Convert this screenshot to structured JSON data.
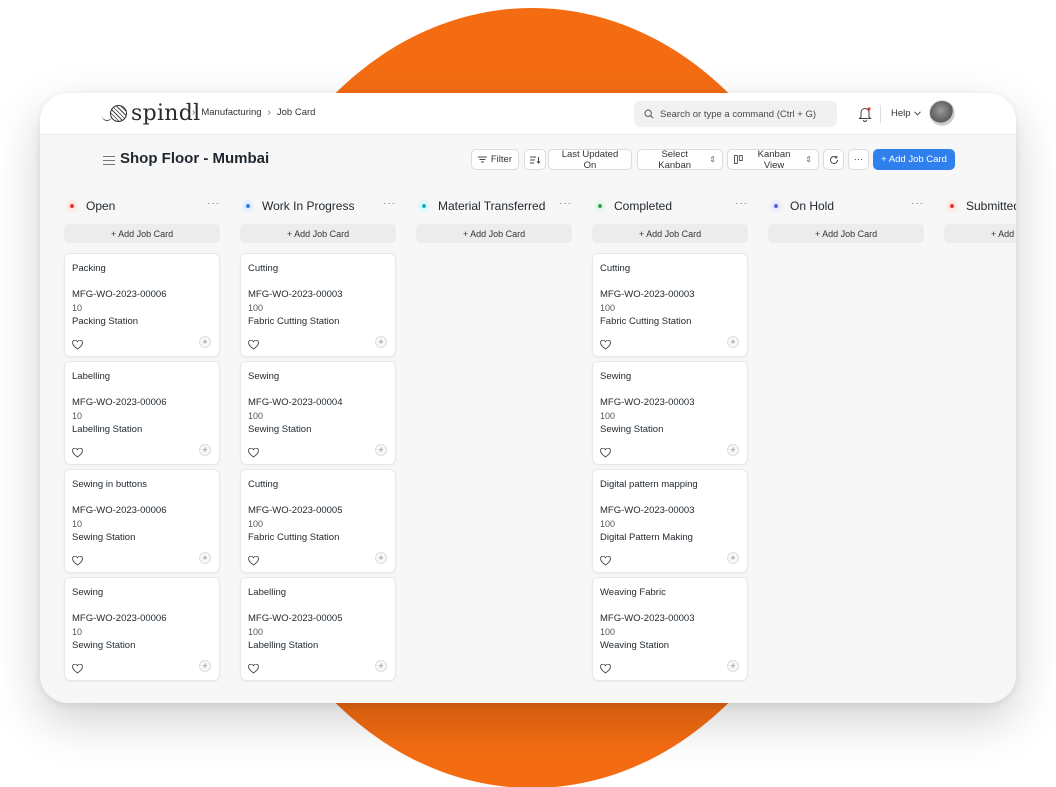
{
  "app": {
    "logo_text": "spindl"
  },
  "breadcrumbs": [
    "Manufacturing",
    "Job Card"
  ],
  "search": {
    "placeholder": "Search or type a command (Ctrl + G)"
  },
  "help_label": "Help",
  "page_title": "Shop Floor - Mumbai",
  "toolbar": {
    "filter": "Filter",
    "sort": "Last Updated On",
    "select_kanban": "Select Kanban",
    "view": "Kanban View",
    "more": "···",
    "add_job_card": "+ Add Job Card"
  },
  "add_label": "+ Add Job Card",
  "columns": [
    {
      "title": "Open",
      "dot_color": "#e03636",
      "dot_bg": "#fde8e8",
      "cards": [
        {
          "operation": "Packing",
          "work_order": "MFG-WO-2023-00006",
          "qty": "10",
          "workstation": "Packing Station"
        },
        {
          "operation": "Labelling",
          "work_order": "MFG-WO-2023-00006",
          "qty": "10",
          "workstation": "Labelling Station"
        },
        {
          "operation": "Sewing in buttons",
          "work_order": "MFG-WO-2023-00006",
          "qty": "10",
          "workstation": "Sewing Station"
        },
        {
          "operation": "Sewing",
          "work_order": "MFG-WO-2023-00006",
          "qty": "10",
          "workstation": "Sewing Station"
        }
      ]
    },
    {
      "title": "Work In Progress",
      "dot_color": "#2f80ed",
      "dot_bg": "#e6f0fd",
      "cards": [
        {
          "operation": "Cutting",
          "work_order": "MFG-WO-2023-00003",
          "qty": "100",
          "workstation": "Fabric Cutting Station"
        },
        {
          "operation": "Sewing",
          "work_order": "MFG-WO-2023-00004",
          "qty": "100",
          "workstation": "Sewing Station"
        },
        {
          "operation": "Cutting",
          "work_order": "MFG-WO-2023-00005",
          "qty": "100",
          "workstation": "Fabric Cutting Station"
        },
        {
          "operation": "Labelling",
          "work_order": "MFG-WO-2023-00005",
          "qty": "100",
          "workstation": "Labelling Station"
        }
      ]
    },
    {
      "title": "Material Transferred",
      "dot_color": "#0fb3c4",
      "dot_bg": "#e0f7f9",
      "cards": []
    },
    {
      "title": "Completed",
      "dot_color": "#2ea44f",
      "dot_bg": "#e6f6eb",
      "cards": [
        {
          "operation": "Cutting",
          "work_order": "MFG-WO-2023-00003",
          "qty": "100",
          "workstation": "Fabric Cutting Station"
        },
        {
          "operation": "Sewing",
          "work_order": "MFG-WO-2023-00003",
          "qty": "100",
          "workstation": "Sewing Station"
        },
        {
          "operation": "Digital pattern mapping",
          "work_order": "MFG-WO-2023-00003",
          "qty": "100",
          "workstation": "Digital Pattern Making"
        },
        {
          "operation": "Weaving Fabric",
          "work_order": "MFG-WO-2023-00003",
          "qty": "100",
          "workstation": "Weaving Station"
        }
      ]
    },
    {
      "title": "On Hold",
      "dot_color": "#5b5fe0",
      "dot_bg": "#ececfc",
      "cards": []
    },
    {
      "title": "Submitted",
      "dot_color": "#e03636",
      "dot_bg": "#fde8e8",
      "cards": []
    }
  ]
}
